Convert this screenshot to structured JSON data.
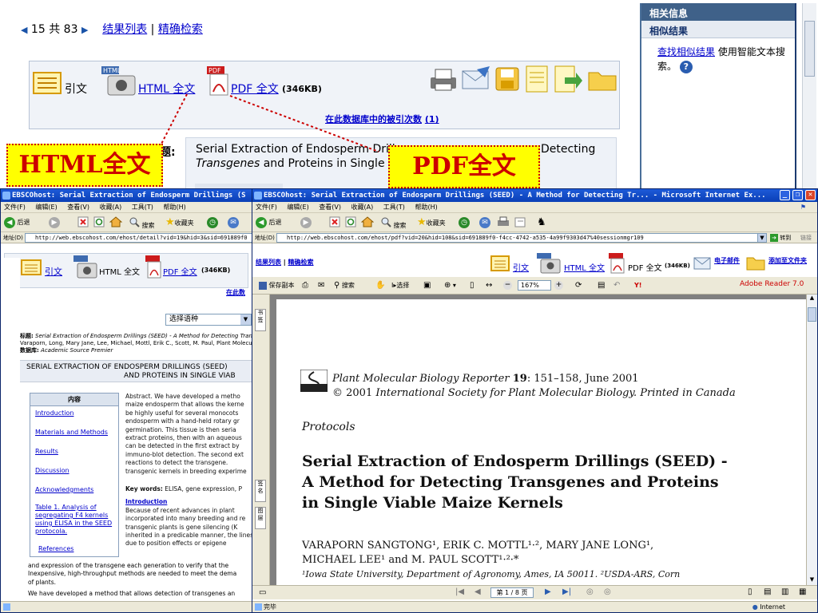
{
  "background_page": {
    "nav": {
      "record_index": "15",
      "of_label": "共",
      "total": "83",
      "results_list": "结果列表",
      "separator": "|",
      "refine_search": "精确检索"
    },
    "toolbox": {
      "citation": "引文",
      "html_fulltext": "HTML 全文",
      "pdf_fulltext": "PDF 全文",
      "pdf_size": "(346KB)",
      "times_cited": "在此数据库中的被引次数",
      "times_cited_count": "(1)"
    },
    "detail": {
      "title_label_fragment": "题:",
      "title_line1": "Serial Extraction of Endosperm Drill",
      "title_line1_end": "Detecting",
      "title_line2_italic": "Transgenes",
      "title_line2_rest": " and Proteins in Single V"
    },
    "right_panel": {
      "header": "相关信息",
      "sub_header": "相似结果",
      "link": "查找相似结果",
      "text": "使用智能文本搜索。"
    }
  },
  "callouts": {
    "html": "HTML全文",
    "pdf": "PDF全文"
  },
  "left_window": {
    "title": "EBSCOhost: Serial Extraction of Endosperm Drillings (S",
    "menu": [
      "文件(F)",
      "编辑(E)",
      "查看(V)",
      "收藏(A)",
      "工具(T)",
      "帮助(H)"
    ],
    "toolbar": {
      "back": "后退",
      "search": "搜索",
      "favorites": "收藏夹"
    },
    "address_label": "地址(D)",
    "url": "http://web.ebscohost.com/ehost/detail?vid=19&hid=3&sid=691889f0",
    "toolbox": {
      "citation": "引文",
      "html_fulltext": "HTML 全文",
      "pdf_fulltext": "PDF 全文",
      "pdf_size": "(346KB)",
      "cut_link": "在此数"
    },
    "language_select": "选择语种",
    "meta": {
      "title_label": "标题:",
      "title_value": "Serial Extraction of Endosperm Drillings (SEED) - A Method for Detecting Transge",
      "authors_line": "Varaporn, Long, Mary Jane, Lee, Michael, Mottl, Erik C., Scott, M. Paul, Plant Molecular",
      "db_label": "数据库:",
      "db_value": "Academic Source Premier"
    },
    "article_title_line1": "SERIAL EXTRACTION OF ENDOSPERM DRILLINGS (SEED)",
    "article_title_line2": "AND PROTEINS IN SINGLE VIAB",
    "toc": {
      "header": "内容",
      "items": [
        "Introduction",
        "Materials and Methods",
        "Results",
        "Discussion",
        "Acknowledgments",
        "Table 1. Analysis of segregating F4 kernels using ELISA in the SEED protocola.",
        "References"
      ]
    },
    "abstract": "Abstract. We have developed a metho maize endosperm that allows the kerne be highly useful for several monocots endosperm with a hand-held rotary gr germination. This tissue is then seria extract proteins, then with an aqueous can be detected in the first extract by immuno-blot detection. The second ext reactions to detect the transgene. transgenic kernels in breeding experime",
    "keywords_label": "Key words:",
    "keywords": "ELISA, gene expression, P",
    "intro_heading": "Introduction",
    "intro_text": "Because of recent advances in plant incorporated into many breeding and re transgenic plants is gene silencing (K inherited in a predicable manner, the lines due to position effects or epigene",
    "bottom_text1": "and expression of the transgene each generation to verify that the",
    "bottom_text2": "Inexpensive, high-throughput methods are needed to meet the dema",
    "bottom_text3": "of plants.",
    "bottom_text4": "We have developed a method that allows detection of transgenes an"
  },
  "right_window": {
    "title": "EBSCOhost: Serial Extraction of Endosperm Drillings (SEED) - A Method for Detecting Tr... - Microsoft Internet Ex...",
    "menu": [
      "文件(F)",
      "编辑(E)",
      "查看(V)",
      "收藏(A)",
      "工具(T)",
      "帮助(H)"
    ],
    "toolbar": {
      "back": "后退",
      "search": "搜索",
      "favorites": "收藏夹"
    },
    "address_label": "地址(D)",
    "url": "http://web.ebscohost.com/ehost/pdf?vid=20&hid=108&sid=691889f0-f4cc-4742-a535-4a99f9303d47%40sessionmgr109",
    "go": "转到",
    "links": "链接",
    "nav": {
      "results_list": "结果列表",
      "separator": "|",
      "refine": "精确检索"
    },
    "toolbox": {
      "citation": "引文",
      "html_fulltext": "HTML 全文",
      "pdf_fulltext": "PDF 全文",
      "pdf_size": "(346KB)",
      "email": "电子邮件",
      "add_folder": "添加至文件夹"
    },
    "pdf_toolbar": {
      "save_copy": "保存副本",
      "search": "搜索",
      "select": "选择",
      "zoom": "167%"
    },
    "adobe": "Adobe Reader 7.0",
    "nav_tabs": {
      "bookmarks": "书签",
      "signatures": "签名",
      "layers": "图层"
    },
    "page_indicator": "第 1 / 8 页",
    "status": "完毕",
    "zone": "Internet",
    "pdf": {
      "journal_line1_prefix": "Plant Molecular Biology Reporter",
      "journal_vol": "19",
      "journal_line1_suffix": ": 151–158, June 2001",
      "journal_line2_prefix": "© 2001 ",
      "journal_line2_italic": "International Society for Plant Molecular Biology. Printed in Canada",
      "section": "Protocols",
      "title_line1": "Serial Extraction of Endosperm Drillings (SEED) -",
      "title_line2": "A Method for Detecting Transgenes and Proteins",
      "title_line3": "in Single Viable Maize Kernels",
      "authors_line1": "VARAPORN SANGTONG¹, ERIK C. MOTTL¹·², MARY JANE LONG¹,",
      "authors_line2": "MICHAEL LEE¹ and M. PAUL SCOTT¹·²·*",
      "affil": "¹Iowa State University, Department of Agronomy, Ames, IA 50011. ²USDA-ARS, Corn"
    }
  }
}
